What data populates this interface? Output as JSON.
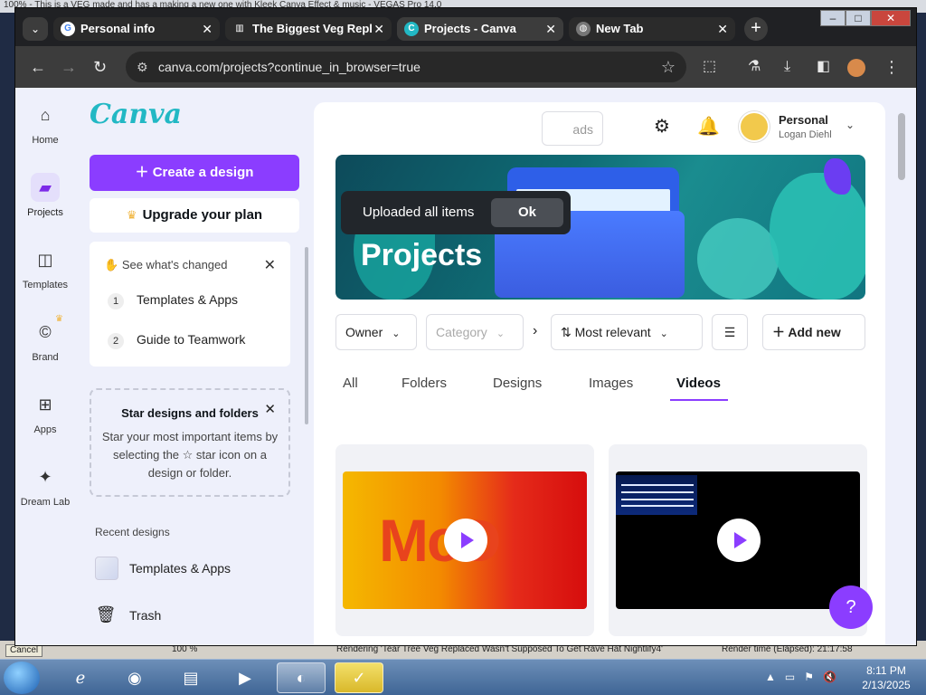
{
  "background_window": {
    "title_snippet": "100% - This is a VEG made and has a making a new one with Kleek Canva Effect & music - VEGAS Pro 14.0",
    "cancel_label": "Cancel",
    "percent": "100 %",
    "render_text": "Rendering 'Tear Tree Veg Replaced Wasn't Supposed To Get Rave Hat Nightlify4'",
    "render_time": "Render time (Elapsed): 21:17:58"
  },
  "browser": {
    "tabs": [
      {
        "label": "Personal info",
        "icon": "google-icon",
        "active": false
      },
      {
        "label": "The Biggest Veg Repl",
        "icon": "library-icon",
        "active": false
      },
      {
        "label": "Projects - Canva",
        "icon": "canva-icon",
        "active": true
      },
      {
        "label": "New Tab",
        "icon": "globe-icon",
        "active": false
      }
    ],
    "url": "canva.com/projects?continue_in_browser=true"
  },
  "rail": [
    {
      "label": "Home",
      "icon": "home-icon"
    },
    {
      "label": "Projects",
      "icon": "folder-icon",
      "active": true
    },
    {
      "label": "Templates",
      "icon": "templates-icon"
    },
    {
      "label": "Brand",
      "icon": "brand-icon"
    },
    {
      "label": "Apps",
      "icon": "apps-icon"
    },
    {
      "label": "Dream Lab",
      "icon": "dream-lab-icon"
    }
  ],
  "sidebar": {
    "logo": "Canva",
    "create_label": "Create a design",
    "upgrade_label": "Upgrade your plan",
    "changes": {
      "title": "See what's changed",
      "items": [
        {
          "num": "1",
          "label": "Templates & Apps"
        },
        {
          "num": "2",
          "label": "Guide to Teamwork"
        }
      ]
    },
    "star_box": {
      "title": "Star designs and folders",
      "desc": "Star your most important items by selecting the ☆ star icon on a design or folder."
    },
    "recent_heading": "Recent designs",
    "recent_items": [
      "Templates & Apps"
    ],
    "trash_label": "Trash"
  },
  "header": {
    "uploads_partial": "ads",
    "account_name": "Personal",
    "account_user": "Logan Diehl"
  },
  "toast": {
    "message": "Uploaded all items",
    "ok_label": "Ok"
  },
  "banner": {
    "title": "Projects"
  },
  "filters": {
    "owner": "Owner",
    "category": "Category",
    "sort": "Most relevant",
    "add_new": "Add new"
  },
  "project_tabs": [
    {
      "label": "All"
    },
    {
      "label": "Folders"
    },
    {
      "label": "Designs"
    },
    {
      "label": "Images"
    },
    {
      "label": "Videos",
      "active": true
    }
  ],
  "videos": [
    {
      "thumb_text": "McD",
      "style": "orange-gradient"
    },
    {
      "thumb_text": "",
      "style": "black-streak"
    }
  ],
  "help_label": "?",
  "taskbar": {
    "time": "8:11 PM",
    "date": "2/13/2025"
  },
  "colors": {
    "accent": "#8b3dff",
    "canva_logo": "#22b8c4"
  }
}
